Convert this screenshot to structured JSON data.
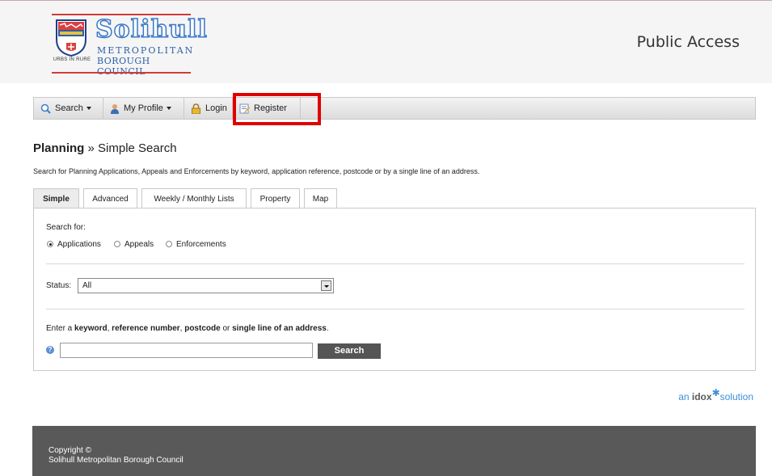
{
  "header": {
    "logo": {
      "word": "Solihull",
      "line1": "METROPOLITAN",
      "line2": "BOROUGH COUNCIL",
      "motto": "URBS IN RURE"
    },
    "site_title": "Public Access"
  },
  "navbar": {
    "items": [
      {
        "label": "Search",
        "icon": "search-icon",
        "dropdown": true
      },
      {
        "label": "My Profile",
        "icon": "user-icon",
        "dropdown": true
      },
      {
        "label": "Login",
        "icon": "lock-icon",
        "dropdown": false
      },
      {
        "label": "Register",
        "icon": "register-icon",
        "dropdown": false
      }
    ],
    "highlight_color": "#e00000"
  },
  "page": {
    "heading_bold": "Planning",
    "heading_rest": " » Simple Search",
    "intro": "Search for Planning Applications, Appeals and Enforcements by keyword, application reference, postcode or by a single line of an address."
  },
  "tabs": [
    {
      "label": "Simple",
      "active": true
    },
    {
      "label": "Advanced",
      "active": false
    },
    {
      "label": "Weekly / Monthly Lists",
      "active": false
    },
    {
      "label": "Property",
      "active": false
    },
    {
      "label": "Map",
      "active": false
    }
  ],
  "form": {
    "search_for_label": "Search for:",
    "radios": [
      {
        "label": "Applications",
        "checked": true
      },
      {
        "label": "Appeals",
        "checked": false
      },
      {
        "label": "Enforcements",
        "checked": false
      }
    ],
    "status_label": "Status:",
    "status_value": "All",
    "prompt_parts": [
      "Enter a ",
      "keyword",
      ", ",
      "reference number",
      ", ",
      "postcode",
      " or ",
      "single line of an address",
      "."
    ],
    "help_glyph": "?",
    "search_value": "",
    "search_button": "Search"
  },
  "branding": {
    "pre": "an ",
    "brand": "idox",
    "post": "solution"
  },
  "footer": {
    "line1": "Copyright ©",
    "line2": "Solihull Metropolitan Borough Council"
  }
}
